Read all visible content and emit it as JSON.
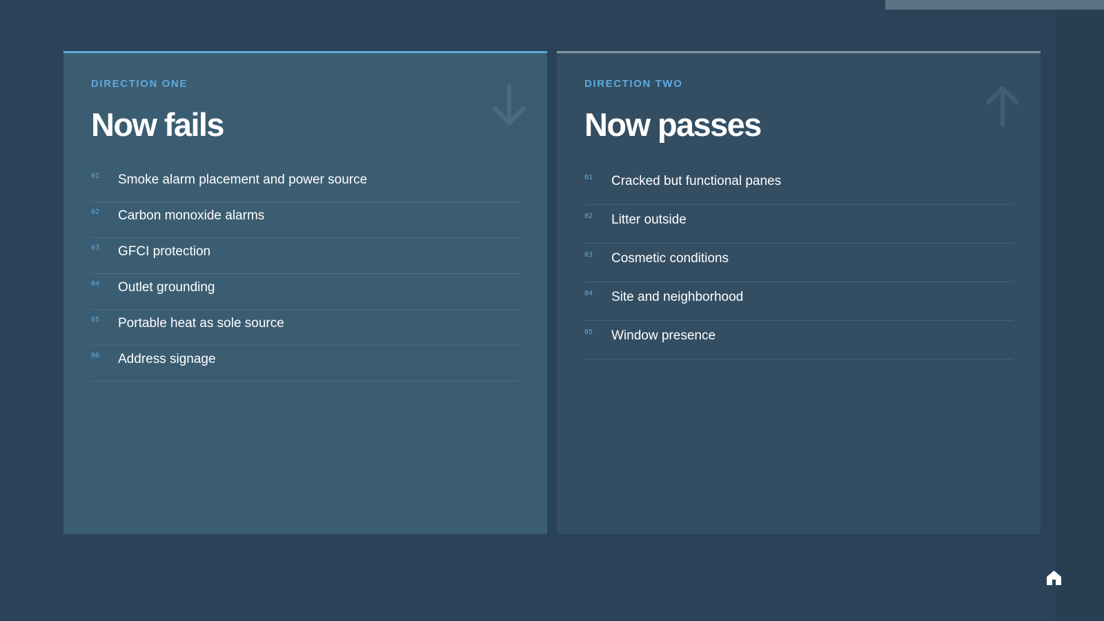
{
  "direction_one": {
    "eyebrow": "DIRECTION ONE",
    "title": "Now fails",
    "arrow_icon": "arrow-down-icon",
    "accent_color": "#5ea9dd",
    "items": [
      {
        "num": "01",
        "text": "Smoke alarm placement and power source"
      },
      {
        "num": "02",
        "text": "Carbon monoxide alarms"
      },
      {
        "num": "03",
        "text": "GFCI protection"
      },
      {
        "num": "04",
        "text": "Outlet grounding"
      },
      {
        "num": "05",
        "text": "Portable heat as sole source"
      },
      {
        "num": "06",
        "text": "Address signage"
      }
    ]
  },
  "direction_two": {
    "eyebrow": "DIRECTION TWO",
    "title": "Now passes",
    "arrow_icon": "arrow-up-icon",
    "accent_color": "#8496a4",
    "items": [
      {
        "num": "01",
        "text": "Cracked but functional panes"
      },
      {
        "num": "02",
        "text": "Litter outside"
      },
      {
        "num": "03",
        "text": "Cosmetic conditions"
      },
      {
        "num": "04",
        "text": "Site and neighborhood"
      },
      {
        "num": "05",
        "text": "Window presence"
      }
    ]
  },
  "footer": {
    "logo_icon": "home-logo-icon"
  },
  "colors": {
    "background": "#2a4358",
    "panel_one_bg": "#3b5d72",
    "panel_two_bg": "#334e63",
    "text": "#ffffff"
  }
}
